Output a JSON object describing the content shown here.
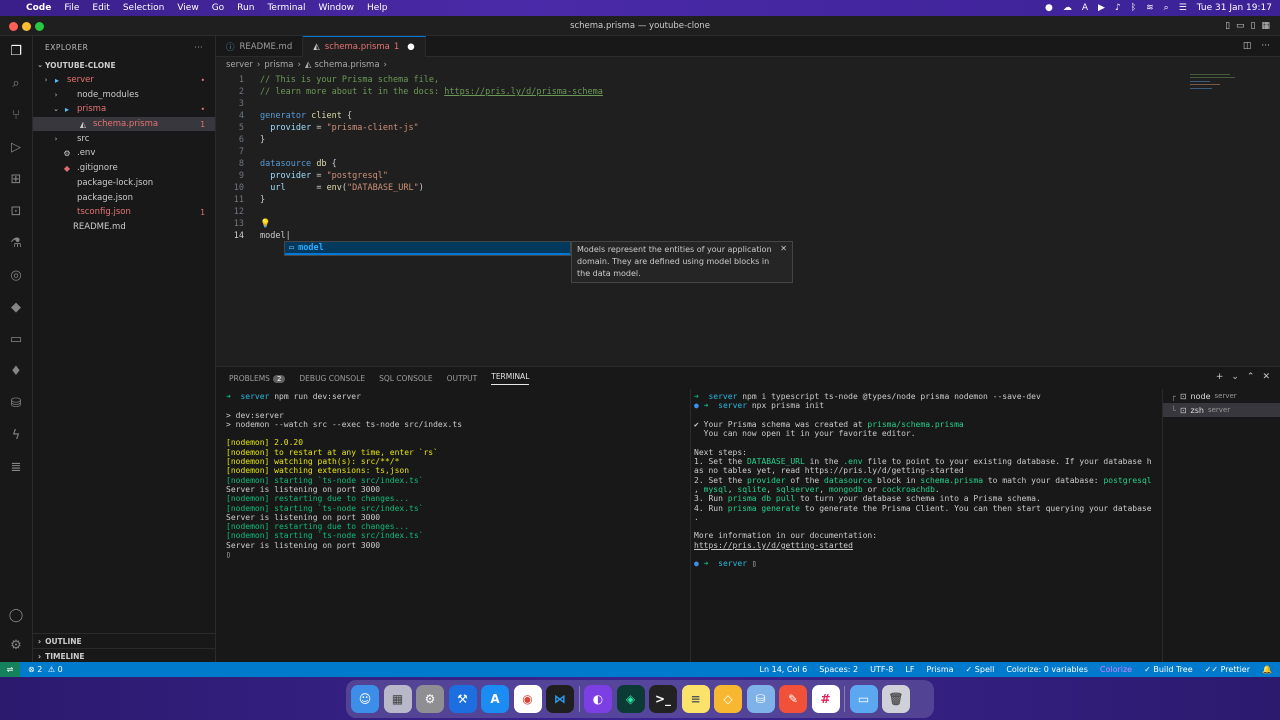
{
  "menubar": {
    "apple": "",
    "app": "Code",
    "items": [
      "File",
      "Edit",
      "Selection",
      "View",
      "Go",
      "Run",
      "Terminal",
      "Window",
      "Help"
    ],
    "clock": "Tue 31 Jan  19:17"
  },
  "window": {
    "title": "schema.prisma — youtube-clone"
  },
  "sidebar": {
    "header": "EXPLORER",
    "root": "YOUTUBE-CLONE",
    "tree": [
      {
        "label": "server",
        "color": "#e57373",
        "badge": "•"
      },
      {
        "label": "node_modules",
        "color": "#cccccc",
        "badge": ""
      },
      {
        "label": "prisma",
        "color": "#e57373",
        "badge": "•"
      },
      {
        "label": "schema.prisma",
        "color": "#e57373",
        "badge": "1"
      },
      {
        "label": "src",
        "color": "#cccccc",
        "badge": ""
      },
      {
        "label": ".env",
        "color": "#cccccc",
        "badge": ""
      },
      {
        "label": ".gitignore",
        "color": "#cccccc",
        "badge": ""
      },
      {
        "label": "package-lock.json",
        "color": "#cccccc",
        "badge": ""
      },
      {
        "label": "package.json",
        "color": "#cccccc",
        "badge": ""
      },
      {
        "label": "tsconfig.json",
        "color": "#e57373",
        "badge": "1"
      },
      {
        "label": "README.md",
        "color": "#cccccc",
        "badge": ""
      }
    ],
    "outline": "OUTLINE",
    "timeline": "TIMELINE"
  },
  "tabs": [
    {
      "label": "README.md",
      "active": false
    },
    {
      "label": "schema.prisma",
      "badge": "1",
      "active": true
    }
  ],
  "breadcrumb": [
    "server",
    "prisma",
    "schema.prisma"
  ],
  "editor": {
    "line_numbers": [
      "1",
      "2",
      "3",
      "4",
      "5",
      "6",
      "7",
      "8",
      "9",
      "10",
      "11",
      "12",
      "13",
      "14"
    ],
    "suggestion": "model",
    "doc": "Models represent the entities of your application domain. They are defined using model blocks in the data model."
  },
  "panel": {
    "tabs": [
      "PROBLEMS",
      "DEBUG CONSOLE",
      "SQL CONSOLE",
      "OUTPUT",
      "TERMINAL"
    ],
    "problems_count": "2",
    "terminals": [
      {
        "name": "node",
        "cwd": "server"
      },
      {
        "name": "zsh",
        "cwd": "server"
      }
    ]
  },
  "status": {
    "errors": "2",
    "warnings": "0",
    "position": "Ln 14, Col 6",
    "spaces": "Spaces: 2",
    "encoding": "UTF-8",
    "eol": "LF",
    "language": "Prisma",
    "spell": "Spell",
    "colorize": "Colorize: 0 variables",
    "colorize2": "Colorize",
    "build": "Build Tree",
    "prettier": "Prettier"
  },
  "dock": [
    "Finder",
    "Launchpad",
    "Settings",
    "Xcode",
    "AppStore",
    "Chrome",
    "VSCode",
    "GitHub",
    "GitKraken",
    "Terminal",
    "Notes",
    "Sketch",
    "DB",
    "Swift",
    "Slack",
    "Folder",
    "Trash"
  ]
}
